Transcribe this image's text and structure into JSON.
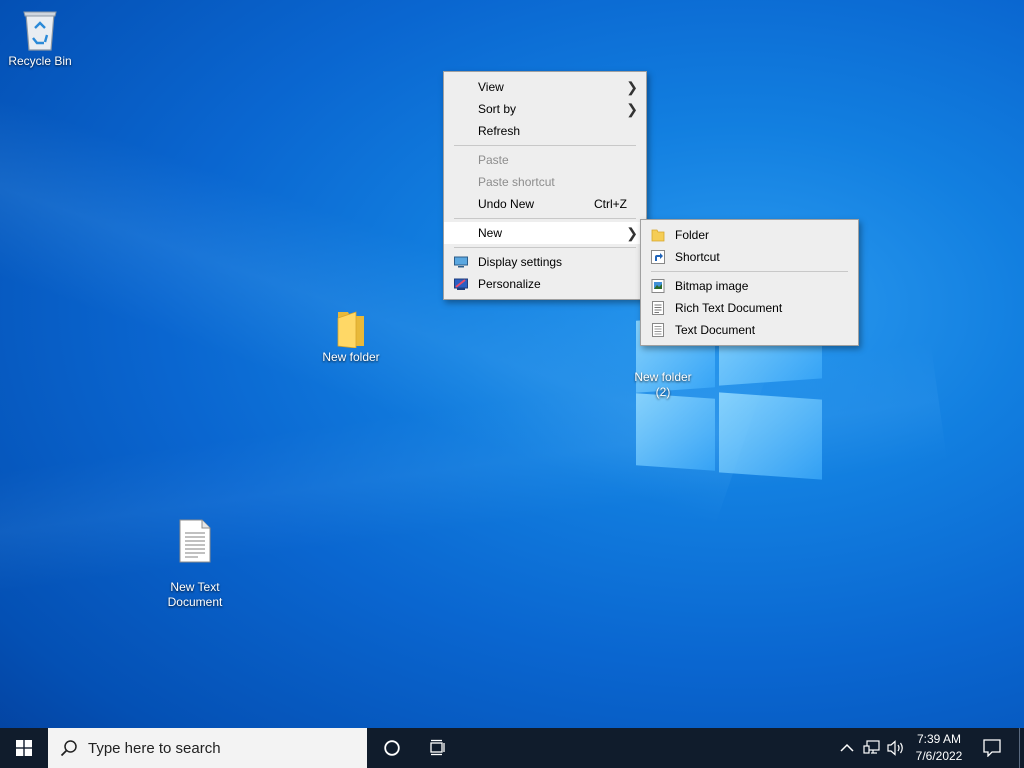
{
  "desktop": {
    "icons": [
      {
        "label": "Recycle Bin",
        "icon": "recycle-bin-icon"
      },
      {
        "label": "New folder",
        "icon": "folder-icon"
      },
      {
        "label": "New folder\n(2)",
        "icon": "folder-icon"
      },
      {
        "label": "New Text\nDocument",
        "icon": "text-document-icon"
      }
    ]
  },
  "context_menu": {
    "view": "View",
    "sort_by": "Sort by",
    "refresh": "Refresh",
    "paste": "Paste",
    "paste_shortcut": "Paste shortcut",
    "undo_new": "Undo New",
    "undo_new_accel": "Ctrl+Z",
    "new": "New",
    "display_settings": "Display settings",
    "personalize": "Personalize"
  },
  "new_submenu": {
    "folder": "Folder",
    "shortcut": "Shortcut",
    "bitmap": "Bitmap image",
    "rich_text": "Rich Text Document",
    "text_document": "Text Document"
  },
  "taskbar": {
    "search_placeholder": "Type here to search",
    "time": "7:39 AM",
    "date": "7/6/2022"
  },
  "colors": {
    "taskbar": "#101c2c",
    "menu_bg": "#eeeeee",
    "menu_hover": "#ffffff",
    "disabled_text": "#8d8d8d"
  }
}
